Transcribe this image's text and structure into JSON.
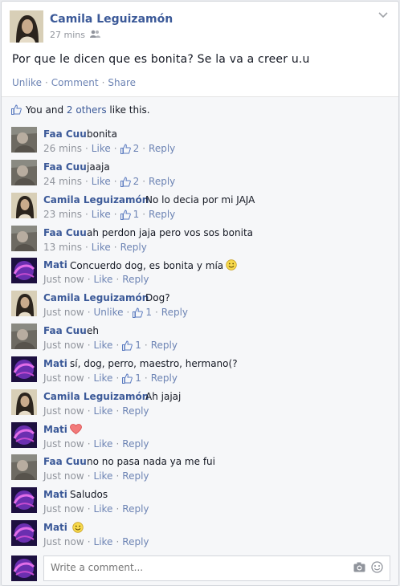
{
  "post": {
    "author": "Camila Leguizamón",
    "time": "27 mins",
    "text": "Por que le dicen que es bonita? Se la va a creer u.u",
    "actions": {
      "unlike": "Unlike",
      "comment": "Comment",
      "share": "Share"
    }
  },
  "likes": {
    "you": "You and",
    "others": "2 others",
    "suffix": "like this."
  },
  "comments": [
    {
      "author": "Faa Cuu",
      "text": "bonita",
      "time": "26 mins",
      "like": "Like",
      "count": "2",
      "reply": "Reply",
      "avatar": "faa"
    },
    {
      "author": "Faa Cuu",
      "text": "jaaja",
      "time": "24 mins",
      "like": "Like",
      "count": "2",
      "reply": "Reply",
      "avatar": "faa"
    },
    {
      "author": "Camila Leguizamón",
      "text": "No lo decia por mi JAJA",
      "time": "23 mins",
      "like": "Like",
      "count": "1",
      "reply": "Reply",
      "avatar": "camila"
    },
    {
      "author": "Faa Cuu",
      "text": "ah perdon jaja pero vos sos bonita",
      "time": "13 mins",
      "like": "Like",
      "count": "",
      "reply": "Reply",
      "avatar": "faa"
    },
    {
      "author": "Mati",
      "text": "Concuerdo dog, es bonita y mía",
      "time": "Just now",
      "like": "Like",
      "count": "",
      "reply": "Reply",
      "avatar": "mati",
      "emoji": "smile"
    },
    {
      "author": "Camila Leguizamón",
      "text": "Dog?",
      "time": "Just now",
      "like": "Unlike",
      "count": "1",
      "reply": "Reply",
      "avatar": "camila"
    },
    {
      "author": "Faa Cuu",
      "text": "eh",
      "time": "Just now",
      "like": "Like",
      "count": "1",
      "reply": "Reply",
      "avatar": "faa"
    },
    {
      "author": "Mati",
      "text": "sí, dog, perro, maestro, hermano(?",
      "time": "Just now",
      "like": "Like",
      "count": "1",
      "reply": "Reply",
      "avatar": "mati"
    },
    {
      "author": "Camila Leguizamón",
      "text": "Ah jajaj",
      "time": "Just now",
      "like": "Like",
      "count": "",
      "reply": "Reply",
      "avatar": "camila"
    },
    {
      "author": "Mati",
      "text": "",
      "time": "Just now",
      "like": "Like",
      "count": "",
      "reply": "Reply",
      "avatar": "mati",
      "emoji": "heart"
    },
    {
      "author": "Faa Cuu",
      "text": "no no pasa nada ya me fui",
      "time": "Just now",
      "like": "Like",
      "count": "",
      "reply": "Reply",
      "avatar": "faa"
    },
    {
      "author": "Mati",
      "text": "Saludos",
      "time": "Just now",
      "like": "Like",
      "count": "",
      "reply": "Reply",
      "avatar": "mati"
    },
    {
      "author": "Mati",
      "text": "",
      "time": "Just now",
      "like": "Like",
      "count": "",
      "reply": "Reply",
      "avatar": "mati",
      "emoji": "smile"
    }
  ],
  "composer": {
    "placeholder": "Write a comment..."
  },
  "colors": {
    "link": "#3b5998",
    "muted": "#90949c",
    "action": "#6d84b4",
    "panel": "#f6f7f9"
  }
}
